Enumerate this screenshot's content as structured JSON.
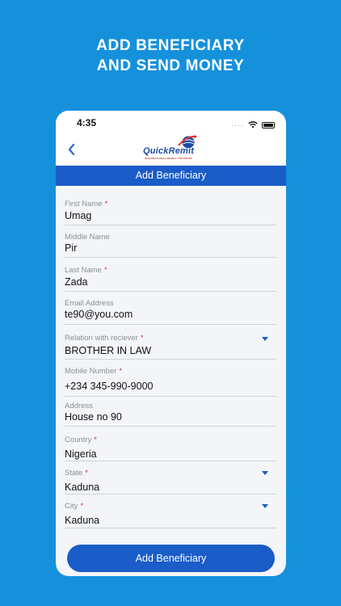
{
  "headline": {
    "line1": "ADD BENEFICIARY",
    "line2": "AND SEND MONEY"
  },
  "status_bar": {
    "time": "4:35",
    "signal": "····",
    "icons": [
      "wifi-icon",
      "battery-icon"
    ]
  },
  "header": {
    "back_icon": "chevron-left-icon",
    "logo_quick": "Quick",
    "logo_remit": "Remit",
    "logo_tagline": "INTERNATIONAL MONEY TRANSFER"
  },
  "page_title": "Add Beneficiary",
  "fields": [
    {
      "label": "First Name",
      "required": true,
      "value": "Umag",
      "dropdown": false
    },
    {
      "label": "Middle Name",
      "required": false,
      "value": "Pir",
      "dropdown": false
    },
    {
      "label": "Last Name",
      "required": true,
      "value": "Zada",
      "dropdown": false
    },
    {
      "label": "Email Address",
      "required": false,
      "value": "te90@you.com",
      "dropdown": false
    },
    {
      "label": "Relation with reciever",
      "required": true,
      "value": "BROTHER IN LAW",
      "dropdown": true
    },
    {
      "label": "Mobile Number",
      "required": true,
      "value": "+234  345-990-9000",
      "dropdown": false
    },
    {
      "label": "Address",
      "required": false,
      "value": "House no 90",
      "dropdown": false
    },
    {
      "label": "Country",
      "required": true,
      "value": "Nigeria",
      "dropdown": false
    },
    {
      "label": "State",
      "required": true,
      "value": "Kaduna",
      "dropdown": true
    },
    {
      "label": "City",
      "required": true,
      "value": "Kaduna",
      "dropdown": true
    }
  ],
  "required_mark": "*",
  "submit_label": "Add Beneficiary",
  "colors": {
    "background": "#1591dc",
    "primary": "#1a5cc8",
    "required": "#e0372f"
  }
}
